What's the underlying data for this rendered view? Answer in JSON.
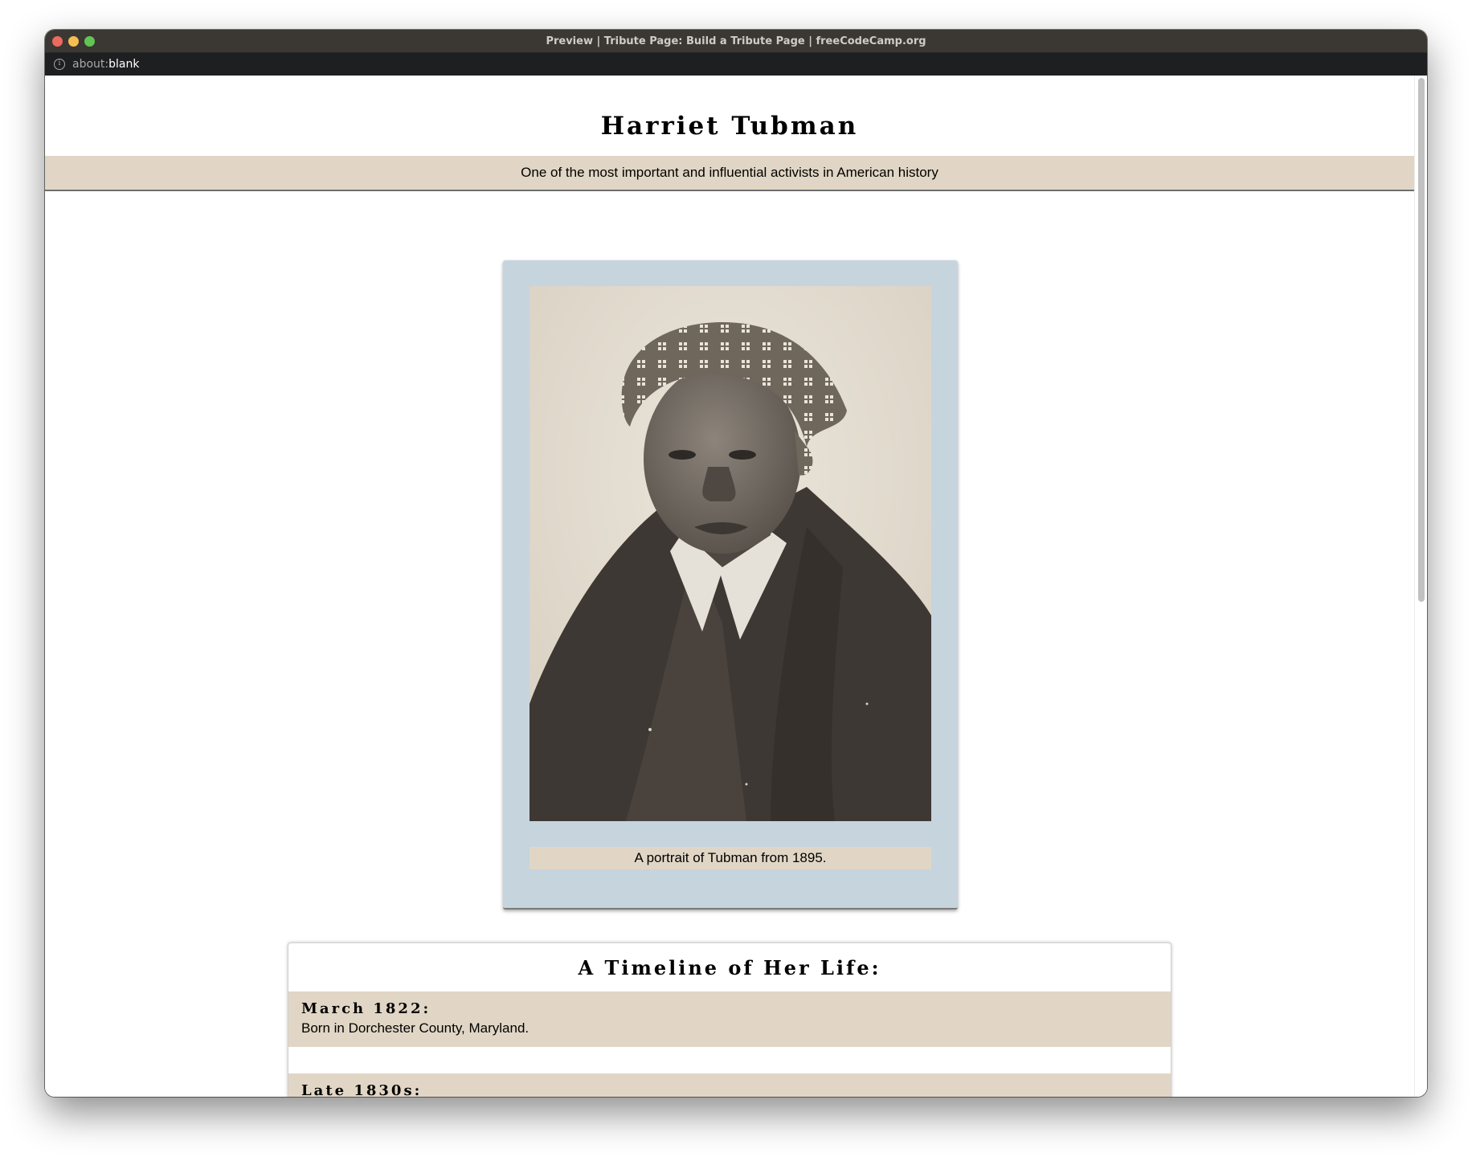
{
  "window": {
    "title": "Preview | Tribute Page: Build a Tribute Page | freeCodeCamp.org",
    "url_prefix": "about:",
    "url_main": "blank"
  },
  "page": {
    "title": "Harriet Tubman",
    "subtitle": "One of the most important and influential activists in American history",
    "image": {
      "caption": "A portrait of Tubman from 1895."
    },
    "timeline": {
      "title": "A Timeline of Her Life:",
      "items": [
        {
          "date": "March 1822:",
          "text": "Born in Dorchester County, Maryland."
        },
        {
          "date": "Late 1830s:",
          "text": ""
        }
      ]
    }
  },
  "colors": {
    "accent_beige": "#e1d6c5",
    "card_blue": "#c6d4de",
    "titlebar": "#3b3733",
    "urlbar": "#1e1f21"
  },
  "icons": {
    "info": "info-icon"
  }
}
